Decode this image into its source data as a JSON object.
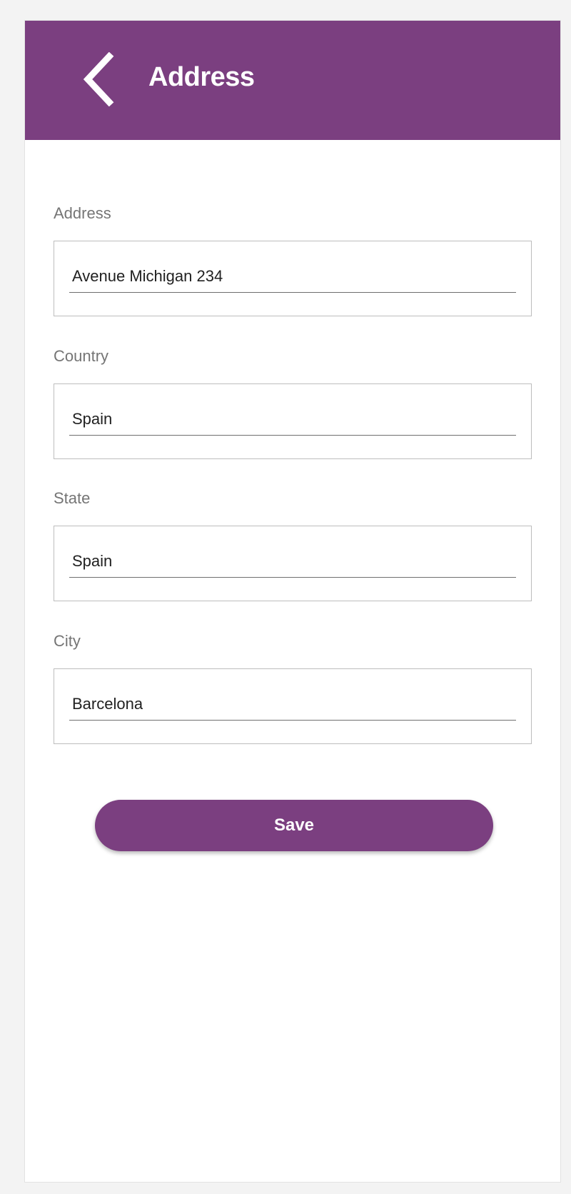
{
  "header": {
    "title": "Address",
    "back_icon": "chevron-left-icon",
    "background_color": "#7b3f80"
  },
  "form": {
    "fields": [
      {
        "label": "Address",
        "value": "Avenue Michigan 234"
      },
      {
        "label": "Country",
        "value": "Spain"
      },
      {
        "label": "State",
        "value": "Spain"
      },
      {
        "label": "City",
        "value": "Barcelona"
      }
    ]
  },
  "actions": {
    "save_label": "Save",
    "accent_color": "#7b3f80"
  }
}
